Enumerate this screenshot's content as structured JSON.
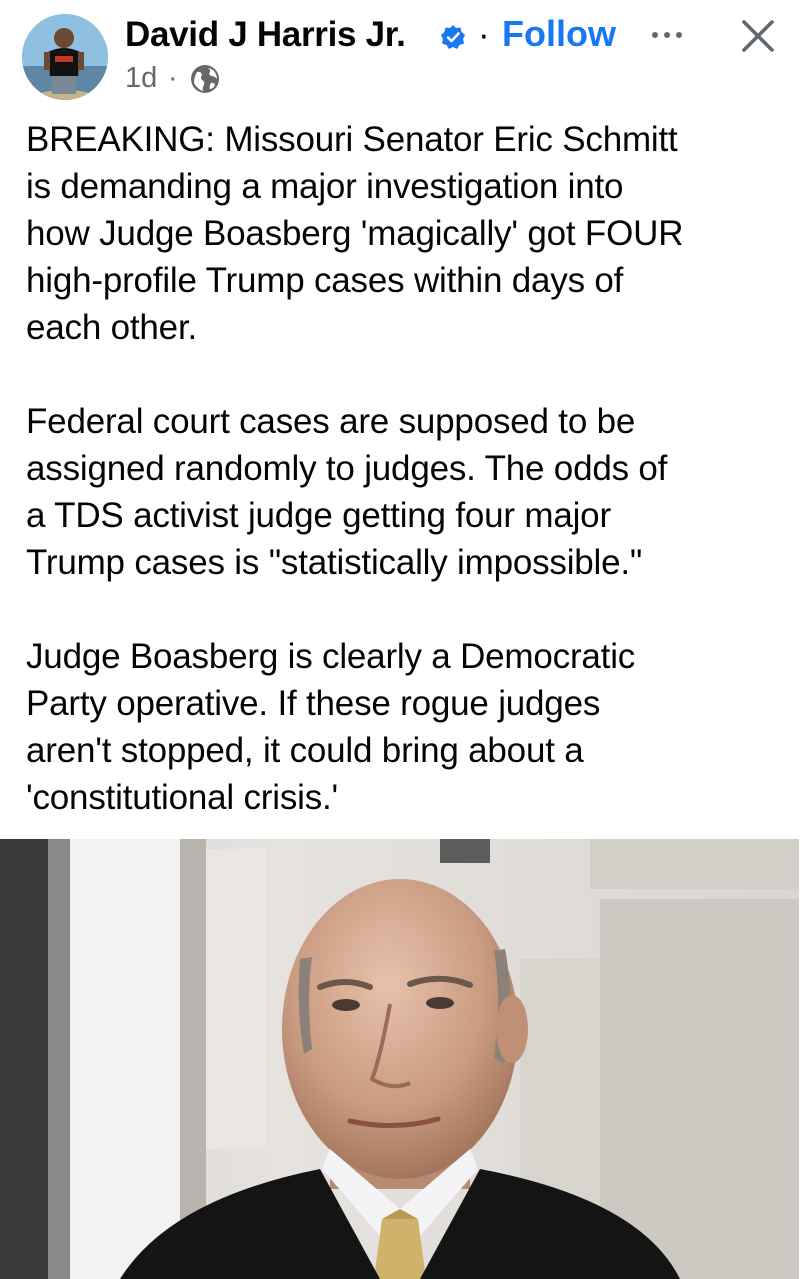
{
  "author": {
    "name": "David J Harris Jr.",
    "verified": true,
    "avatar_icon": "profile-photo"
  },
  "header": {
    "separator": "·",
    "follow_label": "Follow",
    "more_icon": "more-dots-icon",
    "close_icon": "close-icon"
  },
  "meta": {
    "timestamp": "1d",
    "separator": "·",
    "audience_icon": "globe-icon"
  },
  "post": {
    "paragraphs": [
      "BREAKING: Missouri Senator Eric Schmitt\nis demanding a major investigation into\nhow Judge Boasberg 'magically' got FOUR\nhigh-profile Trump cases within days of\neach other.",
      "Federal court cases are supposed to be\nassigned randomly to judges. The odds of\na TDS activist judge getting four major\nTrump cases is \"statistically impossible.\"",
      "Judge Boasberg is clearly a Democratic\nParty operative. If these rogue judges\naren't stopped, it could bring about a\n'constitutional crisis.'"
    ]
  },
  "colors": {
    "link_blue": "#1877f2",
    "text": "#050505",
    "secondary_text": "#65676b"
  }
}
